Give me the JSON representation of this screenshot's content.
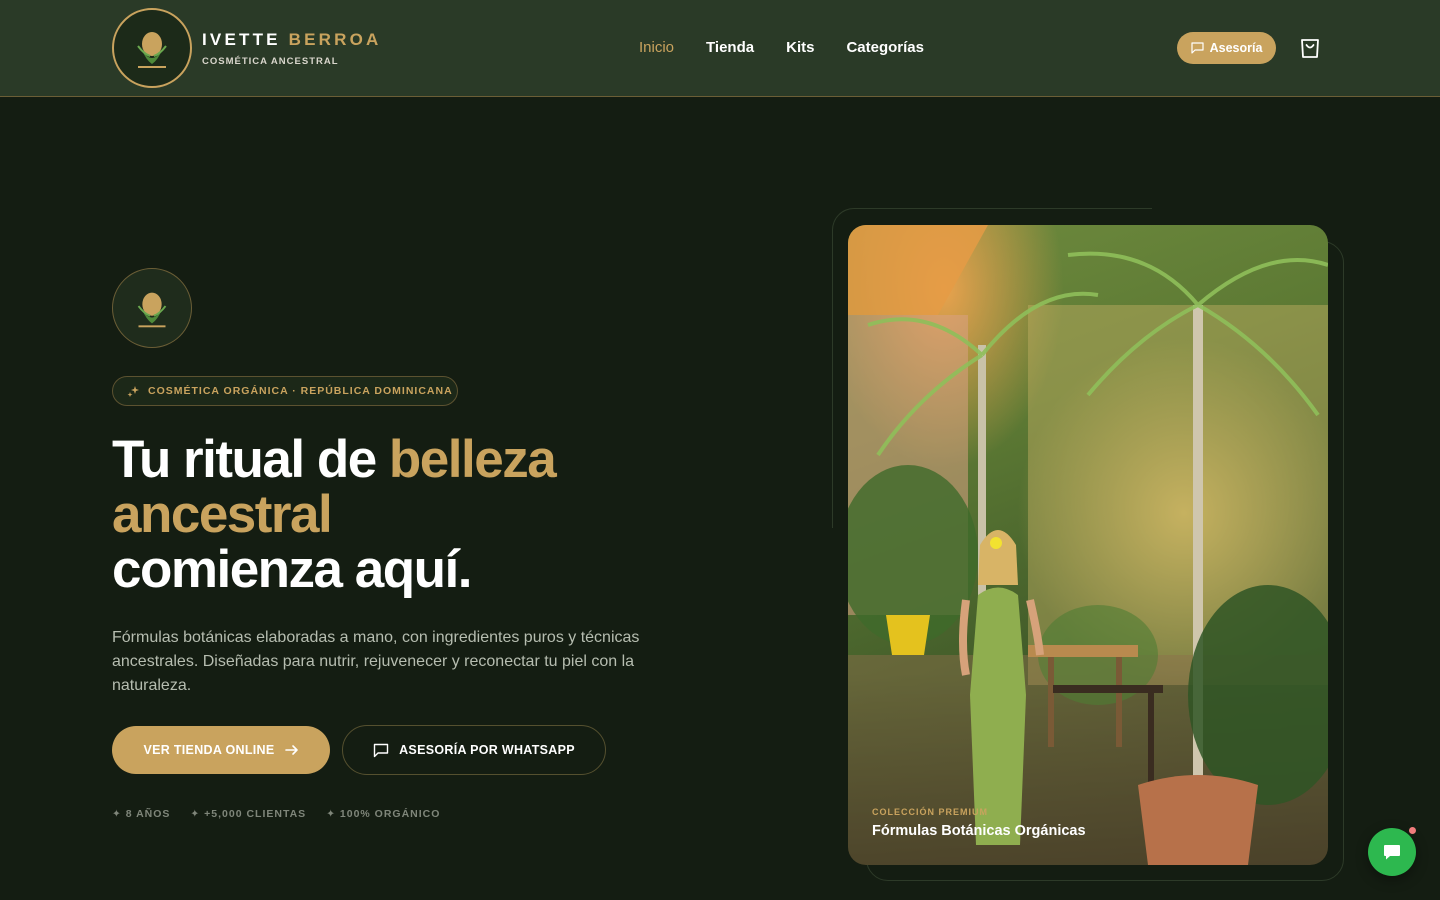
{
  "header": {
    "brand_first": "IVETTE",
    "brand_second": "BERROA",
    "brand_sub": "COSMÉTICA ANCESTRAL",
    "nav": [
      {
        "label": "Inicio",
        "active": true
      },
      {
        "label": "Tienda",
        "active": false
      },
      {
        "label": "Kits",
        "active": false
      },
      {
        "label": "Categorías",
        "active": false
      }
    ],
    "cta_label": "Asesoría",
    "cart_icon": "shopping-bag-icon"
  },
  "hero": {
    "badge": "COSMÉTICA ORGÁNICA · REPÚBLICA DOMINICANA",
    "headline_part1": "Tu ritual de ",
    "headline_gold": "belleza ancestral",
    "headline_part2": "comienza aquí.",
    "description": "Fórmulas botánicas elaboradas a mano, con ingredientes puros y técnicas ancestrales. Diseñadas para nutrir, rejuvenecer y reconectar tu piel con la naturaleza.",
    "primary_button": "VER TIENDA ONLINE",
    "secondary_button": "ASESORÍA POR WHATSAPP",
    "stats": [
      "✦ 8 AÑOS",
      "✦ +5,000 CLIENTAS",
      "✦ 100% ORGÁNICO"
    ]
  },
  "photo": {
    "kicker": "COLECCIÓN PREMIUM",
    "title": "Fórmulas Botánicas Orgánicas"
  },
  "colors": {
    "background": "#141d12",
    "header": "#2a3a27",
    "gold": "#c9a35e",
    "whatsapp": "#2db84f"
  }
}
